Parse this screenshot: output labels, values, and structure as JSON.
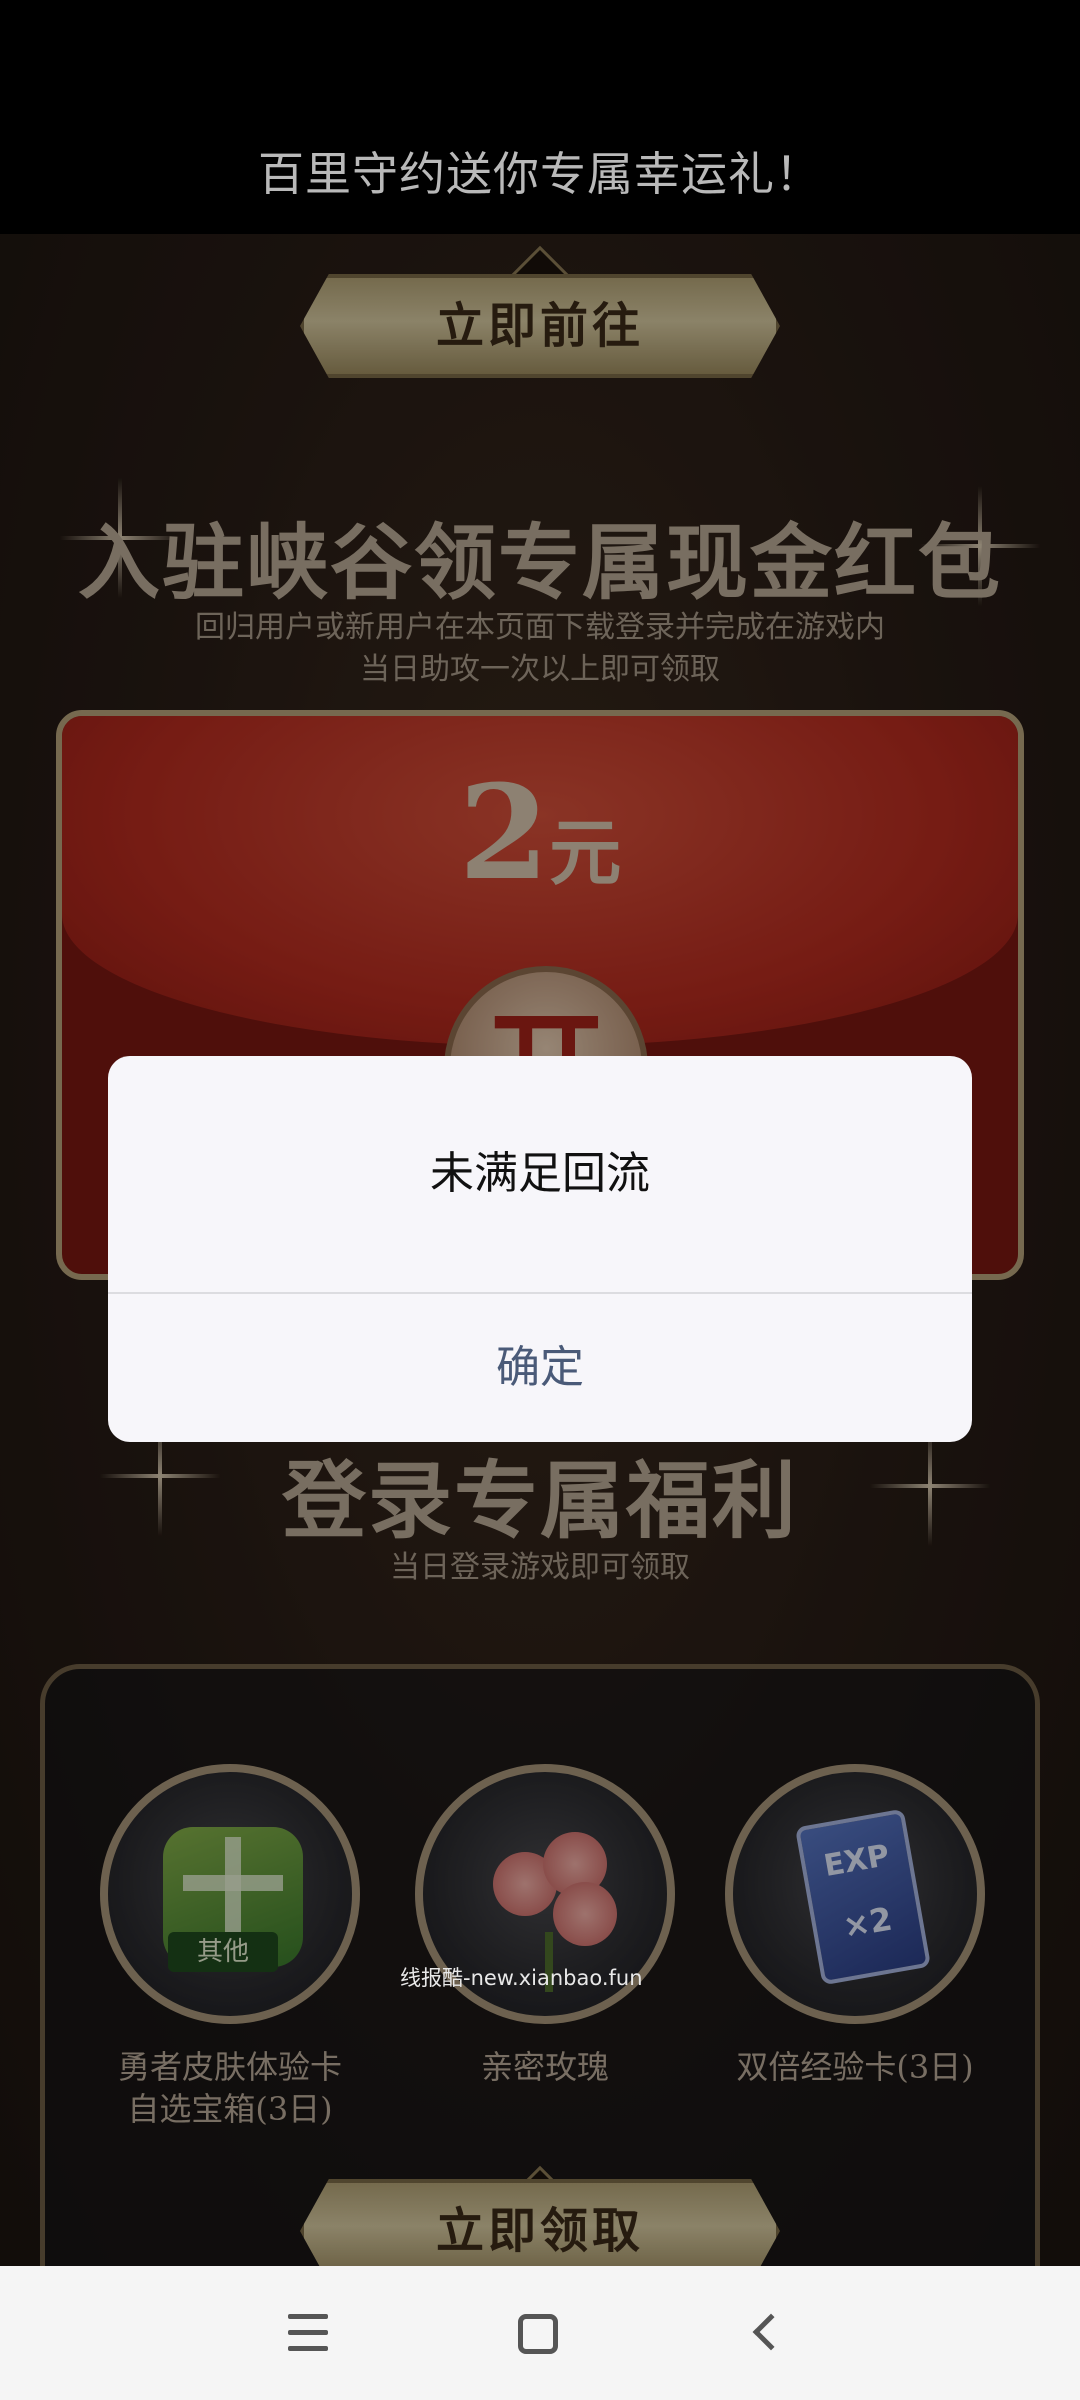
{
  "header": {
    "title": "百里守约送你专属幸运礼！"
  },
  "banner_top": {
    "label": "立即前往"
  },
  "cash_section": {
    "title": "入驻峡谷领专属现金红包",
    "desc_line1": "回归用户或新用户在本页面下载登录并完成在游戏内",
    "desc_line2": "当日助攻一次以上即可领取",
    "envelope": {
      "amount": "2",
      "unit": "元",
      "open_label": "开"
    }
  },
  "login_section": {
    "title": "登录专属福利",
    "desc": "当日登录游戏即可领取",
    "rewards": [
      {
        "name_line1": "勇者皮肤体验卡",
        "name_line2": "自选宝箱(3日)",
        "tag": "其他"
      },
      {
        "name_line1": "亲密玫瑰",
        "name_line2": ""
      },
      {
        "name_line1": "双倍经验卡(3日)",
        "name_line2": "",
        "exp_text": "EXP",
        "multiplier": "×2"
      }
    ]
  },
  "banner_bottom": {
    "label": "立即领取"
  },
  "watermark": "线报酷-new.xianbao.fun",
  "dialog": {
    "message": "未满足回流",
    "confirm_label": "确定"
  },
  "nav": {
    "icons": [
      "menu-icon",
      "home-icon",
      "back-icon"
    ]
  }
}
